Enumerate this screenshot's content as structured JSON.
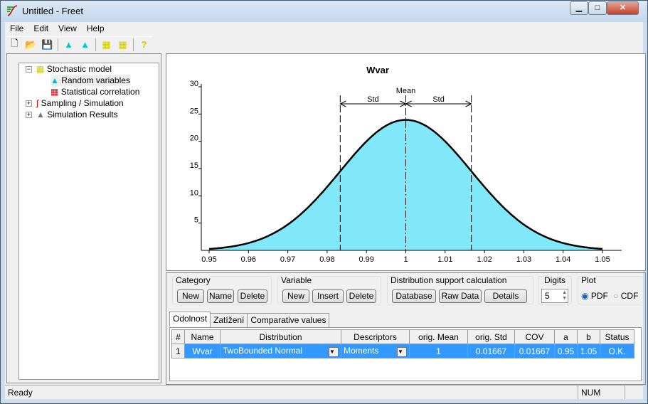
{
  "window": {
    "title": "Untitled - Freet",
    "controls": [
      "minimize",
      "maximize",
      "close"
    ]
  },
  "menu": [
    "File",
    "Edit",
    "View",
    "Help"
  ],
  "toolbar": [
    "new-file-icon",
    "open-folder-icon",
    "save-icon",
    "random-variable-import-icon",
    "random-variable-export-icon",
    "correlation-import-icon",
    "correlation-export-icon",
    "help-icon"
  ],
  "tree": {
    "root": "Stochastic model",
    "children": [
      "Random variables",
      "Statistical correlation"
    ],
    "others": [
      "Sampling / Simulation",
      "Simulation Results"
    ]
  },
  "chart_data": {
    "type": "area",
    "title": "Wvar",
    "distribution": "TwoBounded Normal",
    "mean": 1,
    "std": 0.01667,
    "xlim": [
      0.95,
      1.05
    ],
    "ylim": [
      0,
      30
    ],
    "xticks": [
      "0.95",
      "0.96",
      "0.97",
      "0.98",
      "0.99",
      "1",
      "1.01",
      "1.02",
      "1.03",
      "1.04",
      "1.05"
    ],
    "yticks": [
      "5",
      "10",
      "15",
      "20",
      "25",
      "30"
    ],
    "annotations": {
      "mean": "Mean",
      "std": "Std"
    },
    "fill": "#80e8f8",
    "grid": false
  },
  "panel": {
    "category": {
      "label": "Category",
      "buttons": [
        "New",
        "Name",
        "Delete"
      ]
    },
    "variable": {
      "label": "Variable",
      "buttons": [
        "New",
        "Insert",
        "Delete"
      ]
    },
    "support": {
      "label": "Distribution support calculation",
      "buttons": [
        "Database",
        "Raw Data",
        "Details"
      ]
    },
    "digits": {
      "label": "Digits",
      "value": "5"
    },
    "plot": {
      "label": "Plot",
      "options": [
        "PDF",
        "CDF"
      ],
      "selected": "PDF"
    },
    "tabs": [
      "Odolnost",
      "Zatížení",
      "Comparative values"
    ],
    "columns": [
      "#",
      "Name",
      "Distribution",
      "Descriptors",
      "orig. Mean",
      "orig. Std",
      "COV",
      "a",
      "b",
      "Status"
    ],
    "rows": [
      [
        "1",
        "Wvar",
        "TwoBounded Normal",
        "Moments",
        "1",
        "0.01667",
        "0.01667",
        "0.95",
        "1.05",
        "O.K."
      ]
    ]
  },
  "status": {
    "text": "Ready",
    "num": "NUM"
  }
}
